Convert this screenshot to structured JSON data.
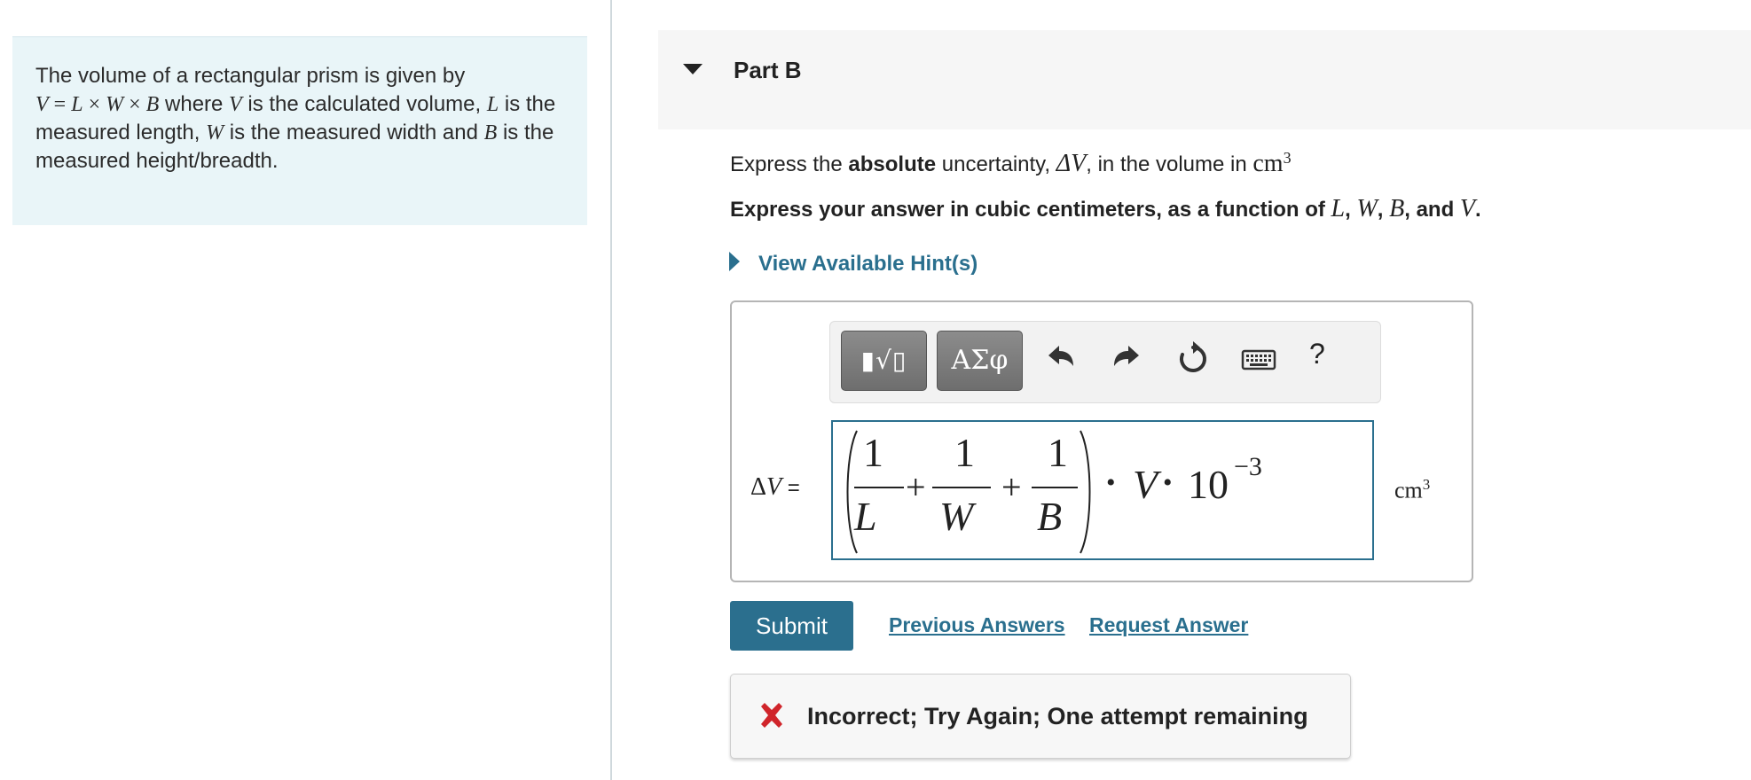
{
  "problem": {
    "intro": "The volume of a rectangular prism is given by",
    "formula_V": "V",
    "formula_eq": " = ",
    "formula_L": "L",
    "formula_x1": " × ",
    "formula_W": "W",
    "formula_x2": " × ",
    "formula_B": "B",
    "where": " where ",
    "var_V": "V",
    "is_calc": " is the calculated volume, ",
    "var_L": "L",
    "is_len": " is the measured length, ",
    "var_W": "W",
    "is_width": " is the measured width and ",
    "var_B": "B",
    "is_height": " is the measured height/breadth."
  },
  "part": {
    "title": "Part B"
  },
  "instructions": {
    "line1_a": "Express the ",
    "line1_bold": "absolute",
    "line1_b": " uncertainty, ",
    "line1_delta": "ΔV",
    "line1_c": ", in the volume in ",
    "line1_unit": "cm",
    "line1_unit_exp": "3",
    "line2_a": "Express your answer in cubic centimeters, as a function of ",
    "line2_L": "L",
    "line2_sep1": ", ",
    "line2_W": "W",
    "line2_sep2": ", ",
    "line2_B": "B",
    "line2_and": ", and ",
    "line2_V": "V",
    "line2_end": "."
  },
  "hint": {
    "label": "View Available Hint(s)"
  },
  "toolbar": {
    "templates_label": "▮√▯",
    "symbols_label": "ΑΣφ",
    "help_label": "?"
  },
  "answer": {
    "delta_sym": "Δ",
    "delta_var": "V",
    "equals": " =",
    "frac1_num": "1",
    "frac1_den": "L",
    "plus1": "+",
    "frac2_num": "1",
    "frac2_den": "W",
    "plus2": "+",
    "frac3_num": "1",
    "frac3_den": "B",
    "dot1": "•",
    "var": "V",
    "dot2": "•",
    "base": "10",
    "exponent": "−3",
    "unit": "cm",
    "unit_exp": "3"
  },
  "actions": {
    "submit": "Submit",
    "previous_answers": "Previous Answers",
    "request_answer": "Request Answer"
  },
  "feedback": {
    "message": "Incorrect; Try Again; One attempt remaining"
  },
  "colors": {
    "accent": "#2b6f8e",
    "problem_bg": "#e9f5f8",
    "error_red": "#d0252b"
  }
}
